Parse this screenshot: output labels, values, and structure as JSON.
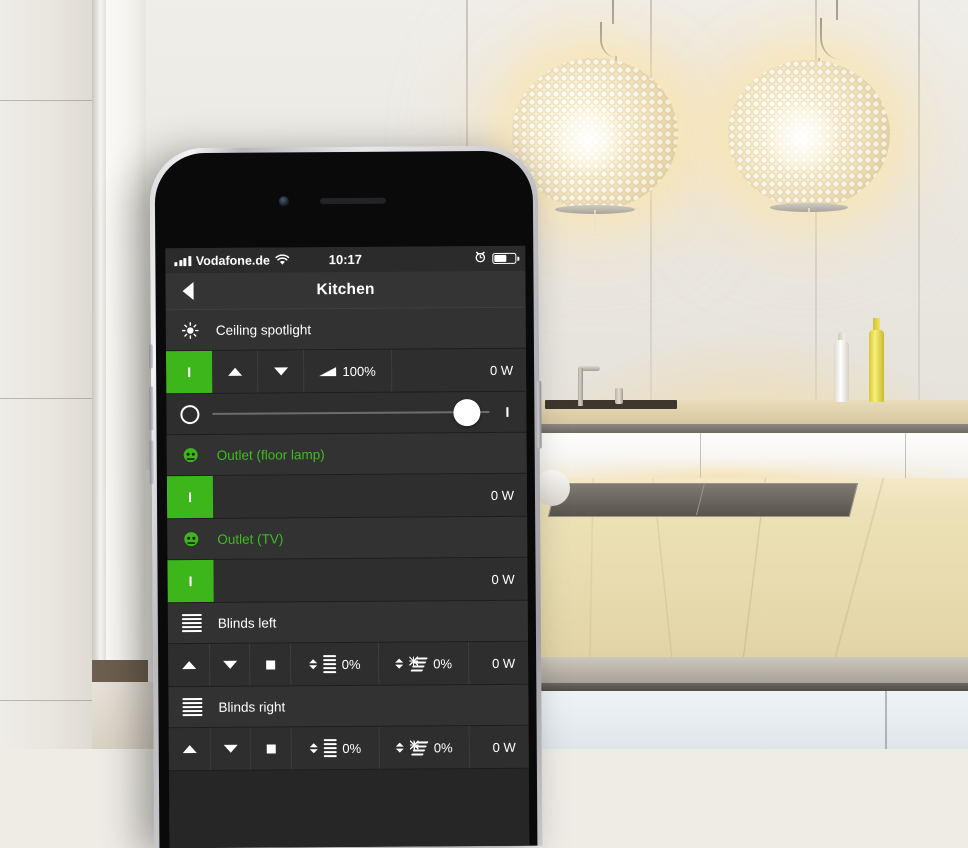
{
  "status_bar": {
    "carrier": "Vodafone.de",
    "time": "10:17",
    "wifi_icon": "wifi-icon",
    "signal_icon": "signal-bars-icon",
    "alarm_icon": "alarm-clock-icon",
    "battery_icon": "battery-icon",
    "battery_level_pct": 62
  },
  "navbar": {
    "back_icon": "back-arrow-icon",
    "title": "Kitchen"
  },
  "theme": {
    "screen_bg": "#262626",
    "row_bg": "#2e2e2e",
    "header_bg": "#323232",
    "accent_green": "#3cb61a",
    "text": "#ffffff"
  },
  "devices": [
    {
      "id": "ceiling-spotlight",
      "name": "Ceiling spotlight",
      "icon": "sun-brightness-icon",
      "name_on": false,
      "controls": {
        "power_label": "I",
        "power_on": true,
        "up_icon": "arrow-up-icon",
        "down_icon": "arrow-down-icon",
        "dim_icon": "brightness-ramp-icon",
        "dim_value": "100%",
        "power_usage": "0 W"
      },
      "slider": {
        "off_label": "O",
        "on_label": "I",
        "value_pct": 92
      }
    },
    {
      "id": "outlet-floor-lamp",
      "name": "Outlet (floor lamp)",
      "icon": "power-outlet-icon",
      "name_on": true,
      "controls": {
        "power_label": "I",
        "power_on": true,
        "power_usage": "0 W"
      }
    },
    {
      "id": "outlet-tv",
      "name": "Outlet (TV)",
      "icon": "power-outlet-icon",
      "name_on": true,
      "controls": {
        "power_label": "I",
        "power_on": true,
        "power_usage": "0 W"
      }
    },
    {
      "id": "blinds-left",
      "name": "Blinds left",
      "icon": "blinds-icon",
      "name_on": false,
      "controls": {
        "up_icon": "arrow-up-icon",
        "down_icon": "arrow-down-icon",
        "stop_icon": "stop-square-icon",
        "position_icon": "blind-position-icon",
        "position_value": "0%",
        "slat_icon": "blind-slat-angle-icon",
        "slat_value": "0%",
        "power_usage": "0 W"
      }
    },
    {
      "id": "blinds-right",
      "name": "Blinds right",
      "icon": "blinds-icon",
      "name_on": false,
      "controls": {
        "up_icon": "arrow-up-icon",
        "down_icon": "arrow-down-icon",
        "stop_icon": "stop-square-icon",
        "position_icon": "blind-position-icon",
        "position_value": "0%",
        "slat_icon": "blind-slat-angle-icon",
        "slat_value": "0%",
        "power_usage": "0 W"
      }
    }
  ]
}
